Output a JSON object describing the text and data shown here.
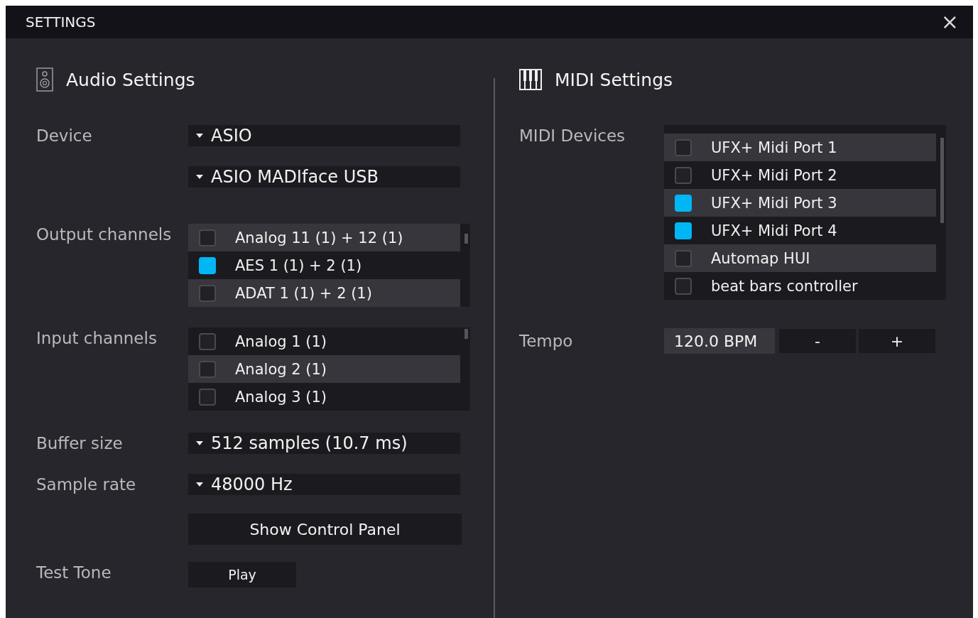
{
  "window": {
    "title": "SETTINGS",
    "close": "×"
  },
  "audio": {
    "heading": "Audio Settings",
    "device_label": "Device",
    "device": "ASIO",
    "driver": "ASIO MADIface USB",
    "output_label": "Output channels",
    "outputs": [
      {
        "label": "Analog 11 (1) + 12 (1)",
        "checked": false
      },
      {
        "label": "AES 1 (1) + 2 (1)",
        "checked": true
      },
      {
        "label": "ADAT 1 (1) + 2 (1)",
        "checked": false
      }
    ],
    "input_label": "Input channels",
    "inputs": [
      {
        "label": "Analog 1 (1)",
        "checked": false
      },
      {
        "label": "Analog 2 (1)",
        "checked": false
      },
      {
        "label": "Analog 3 (1)",
        "checked": false
      }
    ],
    "buffer_label": "Buffer size",
    "buffer": "512 samples (10.7 ms)",
    "rate_label": "Sample rate",
    "rate": "48000 Hz",
    "control_panel": "Show Control Panel",
    "tone_label": "Test Tone",
    "play": "Play"
  },
  "midi": {
    "heading": "MIDI Settings",
    "devices_label": "MIDI Devices",
    "devices": [
      {
        "label": "UFX+ Midi Port 1",
        "checked": false
      },
      {
        "label": "UFX+ Midi Port 2",
        "checked": false
      },
      {
        "label": "UFX+ Midi Port 3",
        "checked": true
      },
      {
        "label": "UFX+ Midi Port 4",
        "checked": true
      },
      {
        "label": "Automap HUI",
        "checked": false
      },
      {
        "label": "beat bars controller",
        "checked": false
      }
    ],
    "tempo_label": "Tempo",
    "tempo": "120.0 BPM",
    "decrease": "-",
    "increase": "+"
  }
}
